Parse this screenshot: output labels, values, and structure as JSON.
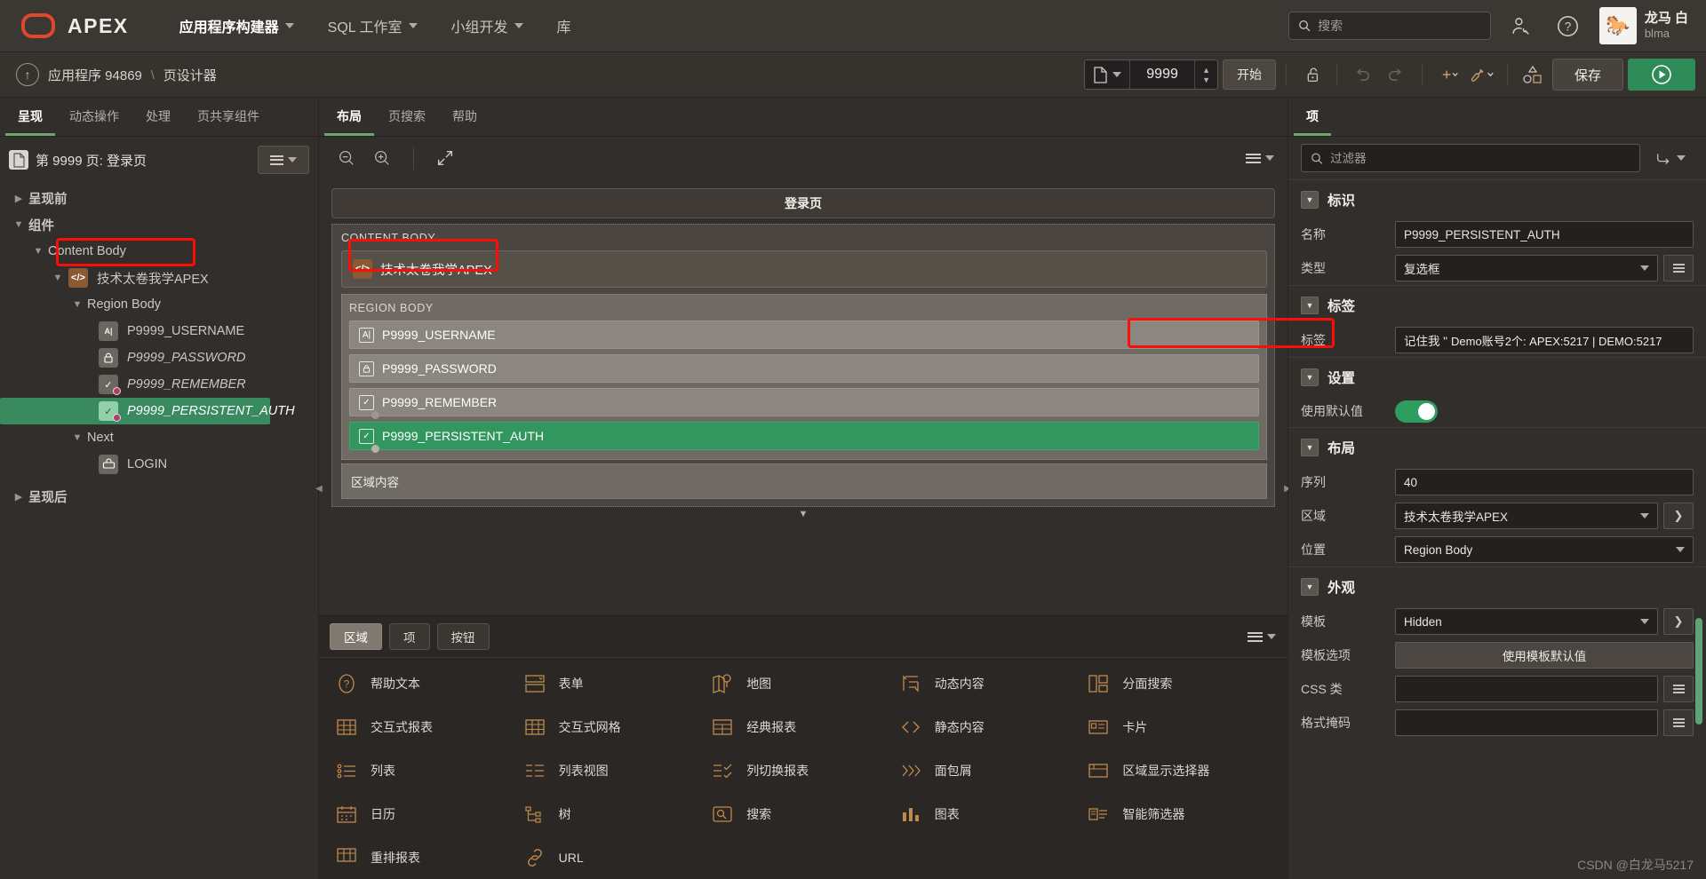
{
  "topnav": {
    "brand": "APEX",
    "logo_color": "#e0472c",
    "items": [
      {
        "label": "应用程序构建器",
        "has_caret": true,
        "active": true
      },
      {
        "label": "SQL 工作室",
        "has_caret": true,
        "active": false
      },
      {
        "label": "小组开发",
        "has_caret": true,
        "active": false
      },
      {
        "label": "库",
        "has_caret": false,
        "active": false
      }
    ],
    "search_placeholder": "搜索",
    "search_value": "",
    "account_icon": "user-settings-icon",
    "help_icon": "help-circle-icon",
    "user": {
      "name": "龙马 白",
      "username": "blma",
      "avatar_glyph": "🐎"
    }
  },
  "toolbar": {
    "back_icon": "up-arrow-circle-icon",
    "breadcrumb": [
      "应用程序 94869",
      "页设计器"
    ],
    "page_selector_icon": "page-icon",
    "page_number": "9999",
    "start_label": "开始",
    "lock_icon": "unlock-icon",
    "undo_icon": "undo-icon",
    "redo_icon": "redo-icon",
    "add_icon": "plus-icon",
    "utilities_icon": "wrench-icon",
    "shapes_icon": "shapes-icon",
    "save_label": "保存",
    "run_icon": "play-icon",
    "run_color": "#2e8b57"
  },
  "left": {
    "tabs": [
      {
        "label": "呈现",
        "active": true
      },
      {
        "label": "动态操作",
        "active": false
      },
      {
        "label": "处理",
        "active": false
      },
      {
        "label": "页共享组件",
        "active": false
      }
    ],
    "header_title": "第 9999 页: 登录页",
    "header_icon": "page-icon",
    "menu_button": "list-menu-button",
    "tree": [
      {
        "label": "呈现前",
        "depth": 1,
        "twisty": "collapsed",
        "icon": "",
        "italic": false,
        "selected": false,
        "annotated": false
      },
      {
        "label": "组件",
        "depth": 1,
        "twisty": "expanded",
        "icon": "",
        "italic": false,
        "selected": false,
        "annotated": false
      },
      {
        "label": "Content Body",
        "depth": 2,
        "twisty": "expanded",
        "icon": "",
        "italic": false,
        "selected": false,
        "annotated": false
      },
      {
        "label": "技术太卷我学APEX",
        "depth": 3,
        "twisty": "expanded",
        "icon": "code",
        "italic": false,
        "selected": false,
        "annotated": true
      },
      {
        "label": "Region Body",
        "depth": 4,
        "twisty": "expanded",
        "icon": "",
        "italic": false,
        "selected": false,
        "annotated": false
      },
      {
        "label": "P9999_USERNAME",
        "depth": 5,
        "twisty": "",
        "icon": "text",
        "italic": false,
        "selected": false,
        "annotated": false
      },
      {
        "label": "P9999_PASSWORD",
        "depth": 5,
        "twisty": "",
        "icon": "lock",
        "italic": false,
        "selected": false,
        "annotated": false
      },
      {
        "label": "P9999_REMEMBER",
        "depth": 5,
        "twisty": "",
        "icon": "check",
        "italic": true,
        "selected": false,
        "annotated": false,
        "dot": true
      },
      {
        "label": "P9999_PERSISTENT_AUTH",
        "depth": 5,
        "twisty": "",
        "icon": "check",
        "italic": true,
        "selected": true,
        "annotated": false,
        "dot": true
      },
      {
        "label": "Next",
        "depth": 3,
        "twisty": "expanded",
        "icon": "",
        "italic": false,
        "selected": false,
        "annotated": false
      },
      {
        "label": "LOGIN",
        "depth": 4,
        "twisty": "",
        "icon": "button",
        "italic": false,
        "selected": false,
        "annotated": false
      },
      {
        "label": "呈现后",
        "depth": 1,
        "twisty": "collapsed",
        "icon": "",
        "italic": false,
        "selected": false,
        "annotated": false
      }
    ]
  },
  "center": {
    "tabs": [
      {
        "label": "布局",
        "active": true
      },
      {
        "label": "页搜索",
        "active": false
      },
      {
        "label": "帮助",
        "active": false
      }
    ],
    "zoom_out_icon": "zoom-out-icon",
    "zoom_in_icon": "zoom-in-icon",
    "expand_icon": "expand-icon",
    "menu_icon": "list-menu-icon",
    "page_title": "登录页",
    "content_body_label": "CONTENT BODY",
    "region": {
      "icon": "code-icon",
      "title": "技术太卷我学APEX",
      "annotated": true,
      "body_label": "REGION BODY",
      "items": [
        {
          "label": "P9999_USERNAME",
          "icon": "text",
          "selected": false,
          "dot": false
        },
        {
          "label": "P9999_PASSWORD",
          "icon": "lock",
          "selected": false,
          "dot": false
        },
        {
          "label": "P9999_REMEMBER",
          "icon": "check",
          "selected": false,
          "dot": true
        },
        {
          "label": "P9999_PERSISTENT_AUTH",
          "icon": "check",
          "selected": true,
          "dot": true
        }
      ]
    },
    "region_content_label": "区域内容",
    "gallery": {
      "tabs": [
        {
          "label": "区域",
          "active": true
        },
        {
          "label": "项",
          "active": false
        },
        {
          "label": "按钮",
          "active": false
        }
      ],
      "menu_icon": "list-menu-icon",
      "items": [
        {
          "label": "帮助文本",
          "icon": "help-text-icon"
        },
        {
          "label": "表单",
          "icon": "form-icon"
        },
        {
          "label": "地图",
          "icon": "map-icon"
        },
        {
          "label": "动态内容",
          "icon": "dynamic-content-icon"
        },
        {
          "label": "分面搜索",
          "icon": "faceted-search-icon"
        },
        {
          "label": "交互式报表",
          "icon": "interactive-report-icon"
        },
        {
          "label": "交互式网格",
          "icon": "interactive-grid-icon"
        },
        {
          "label": "经典报表",
          "icon": "classic-report-icon"
        },
        {
          "label": "静态内容",
          "icon": "static-content-icon"
        },
        {
          "label": "卡片",
          "icon": "cards-icon"
        },
        {
          "label": "列表",
          "icon": "list-icon"
        },
        {
          "label": "列表视图",
          "icon": "list-view-icon"
        },
        {
          "label": "列切换报表",
          "icon": "column-toggle-icon"
        },
        {
          "label": "面包屑",
          "icon": "breadcrumb-icon"
        },
        {
          "label": "区域显示选择器",
          "icon": "region-display-selector-icon"
        },
        {
          "label": "日历",
          "icon": "calendar-icon"
        },
        {
          "label": "树",
          "icon": "tree-icon"
        },
        {
          "label": "搜索",
          "icon": "search-icon"
        },
        {
          "label": "图表",
          "icon": "chart-icon"
        },
        {
          "label": "智能筛选器",
          "icon": "smart-filter-icon"
        },
        {
          "label": "重排报表",
          "icon": "reflow-report-icon"
        },
        {
          "label": "URL",
          "icon": "url-icon"
        }
      ]
    }
  },
  "right": {
    "tabs": [
      {
        "label": "项",
        "active": true
      }
    ],
    "filter_placeholder": "过滤器",
    "filter_value": "",
    "filter_button_icon": "expand-collapse-icon",
    "groups": [
      {
        "title": "标识",
        "rows": [
          {
            "label": "名称",
            "type": "text",
            "value": "P9999_PERSISTENT_AUTH"
          },
          {
            "label": "类型",
            "type": "select",
            "value": "复选框",
            "has_list_button": true
          }
        ]
      },
      {
        "title": "标签",
        "rows": [
          {
            "label": "标签",
            "type": "text",
            "value": "记住我 \"",
            "annotated_value": "Demo账号2个:  APEX:5217 | DEMO:5217",
            "annotated": true
          }
        ]
      },
      {
        "title": "设置",
        "rows": [
          {
            "label": "使用默认值",
            "type": "toggle",
            "value": "on",
            "color": "#2e9e60"
          }
        ]
      },
      {
        "title": "布局",
        "rows": [
          {
            "label": "序列",
            "type": "text",
            "value": "40"
          },
          {
            "label": "区域",
            "type": "select",
            "value": "技术太卷我学APEX",
            "has_next_button": true
          },
          {
            "label": "位置",
            "type": "select",
            "value": "Region Body"
          }
        ]
      },
      {
        "title": "外观",
        "rows": [
          {
            "label": "模板",
            "type": "select",
            "value": "Hidden",
            "has_next_button": true
          },
          {
            "label": "模板选项",
            "type": "button",
            "value": "使用模板默认值"
          },
          {
            "label": "CSS 类",
            "type": "text",
            "value": "",
            "has_list_button": true
          },
          {
            "label": "格式掩码",
            "type": "text",
            "value": "",
            "has_list_button": true
          }
        ]
      }
    ]
  },
  "watermark": "CSDN @白龙马5217"
}
